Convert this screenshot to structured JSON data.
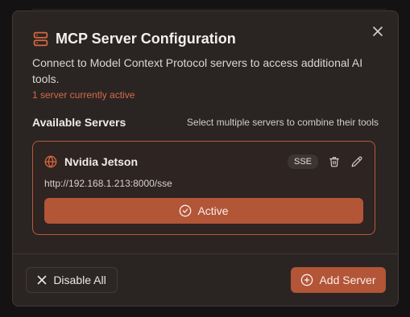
{
  "dialog": {
    "title": "MCP Server Configuration",
    "title_icon": "server-icon",
    "description": "Connect to Model Context Protocol servers to access additional AI tools.",
    "status": "1 server currently active"
  },
  "servers_section": {
    "title": "Available Servers",
    "hint": "Select multiple servers to combine their tools"
  },
  "servers": [
    {
      "name": "Nvidia Jetson",
      "icon": "globe-icon",
      "badge": "SSE",
      "url": "http://192.168.1.213:8000/sse",
      "active_label": "Active"
    }
  ],
  "footer": {
    "disable_all_label": "Disable All",
    "add_server_label": "Add Server"
  },
  "colors": {
    "accent": "#b35537",
    "accent_border": "#b9583c",
    "status_text": "#d46a47",
    "dialog_bg": "#2a2523"
  }
}
